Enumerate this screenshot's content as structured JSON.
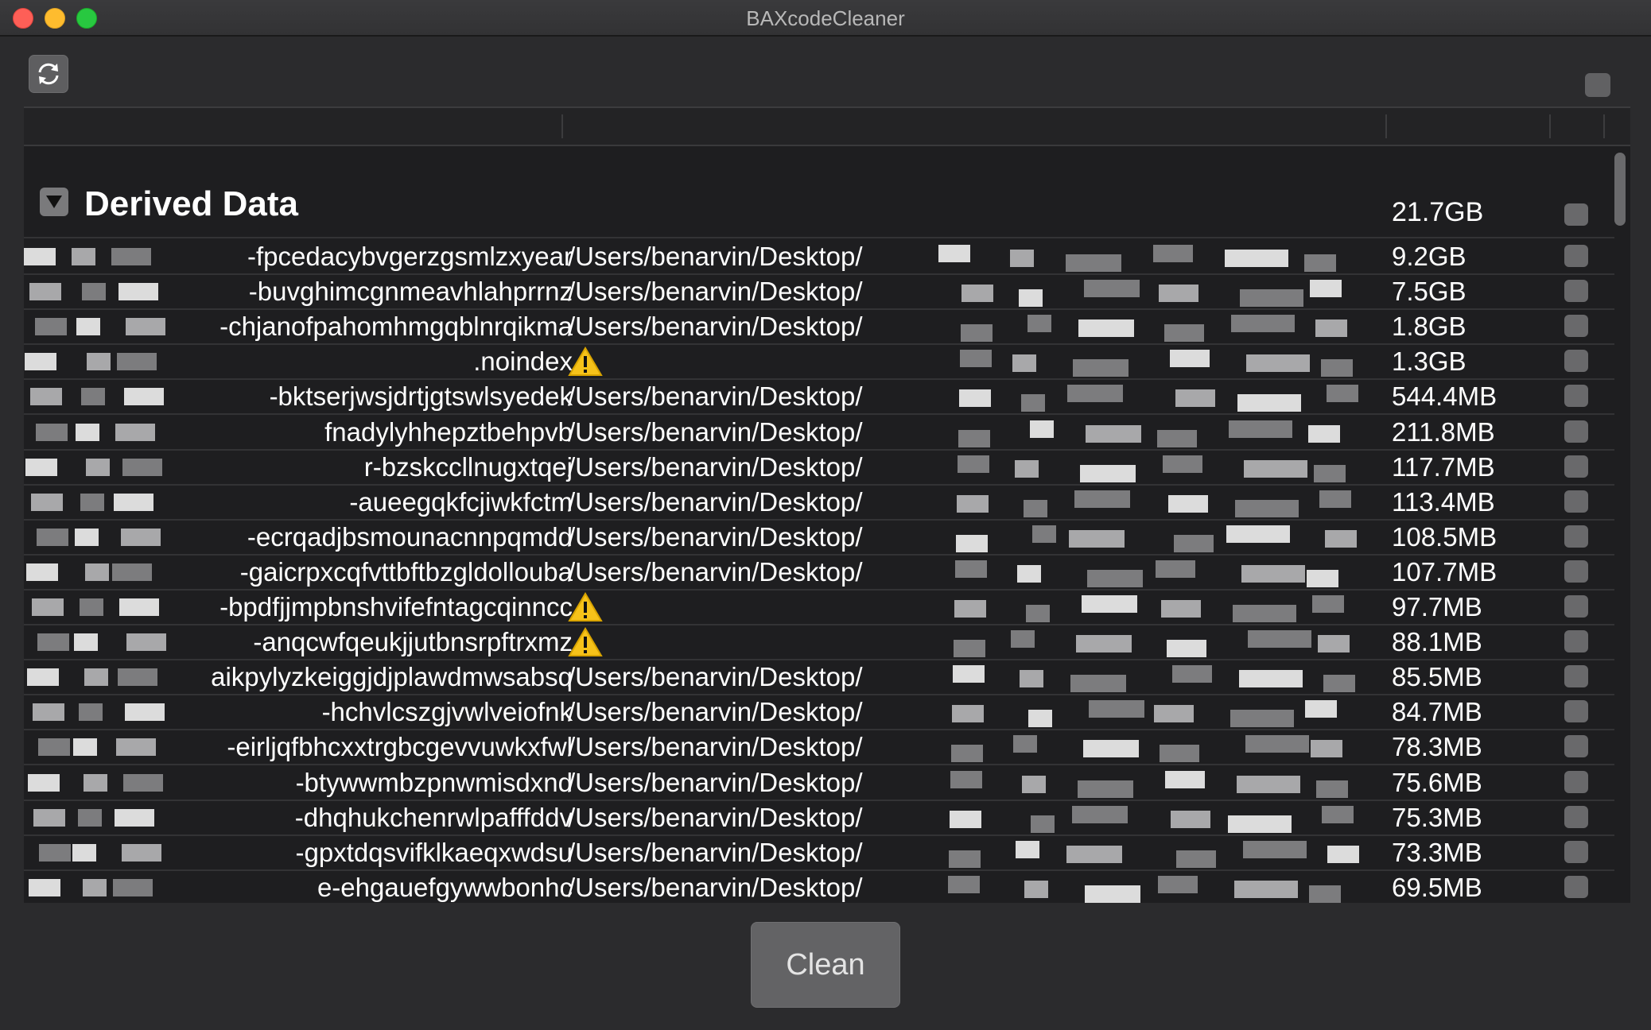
{
  "window": {
    "title": "BAXcodeCleaner"
  },
  "toolbar": {
    "refresh_icon": "refresh-icon"
  },
  "group": {
    "title": "Derived Data",
    "total_size": "21.7GB"
  },
  "rows": [
    {
      "name": "-fpcedacybvgerzgsmlzxyear",
      "path": "/Users/benarvin/Desktop/",
      "size": "9.2GB",
      "warning": false
    },
    {
      "name": "-buvghimcgnmeavhlahprrnz",
      "path": "/Users/benarvin/Desktop/",
      "size": "7.5GB",
      "warning": false
    },
    {
      "name": "-chjanofpahomhmgqblnrqikma",
      "path": "/Users/benarvin/Desktop/",
      "size": "1.8GB",
      "warning": false
    },
    {
      "name": ".noindex",
      "path": "",
      "size": "1.3GB",
      "warning": true
    },
    {
      "name": "-bktserjwsjdrtjgtswlsyedek",
      "path": "/Users/benarvin/Desktop/",
      "size": "544.4MB",
      "warning": false
    },
    {
      "name": "fnadylyhhepztbehpvb",
      "path": "/Users/benarvin/Desktop/",
      "size": "211.8MB",
      "warning": false
    },
    {
      "name": "r-bzskccllnugxtqej",
      "path": "/Users/benarvin/Desktop/",
      "size": "117.7MB",
      "warning": false
    },
    {
      "name": "-aueegqkfcjiwkfctm",
      "path": "/Users/benarvin/Desktop/",
      "size": "113.4MB",
      "warning": false
    },
    {
      "name": "-ecrqadjbsmounacnnpqmdd",
      "path": "/Users/benarvin/Desktop/",
      "size": "108.5MB",
      "warning": false
    },
    {
      "name": "-gaicrpxcqfvttbftbzgldollouba",
      "path": "/Users/benarvin/Desktop/",
      "size": "107.7MB",
      "warning": false
    },
    {
      "name": "-bpdfjjmpbnshvifefntagcqinncc",
      "path": "",
      "size": "97.7MB",
      "warning": true
    },
    {
      "name": "-anqcwfqeukjjutbnsrpftrxmz",
      "path": "",
      "size": "88.1MB",
      "warning": true
    },
    {
      "name": "aikpylyzkeiggjdjplawdmwsabsq",
      "path": "/Users/benarvin/Desktop/",
      "size": "85.5MB",
      "warning": false
    },
    {
      "name": "-hchvlcszgjvwlveiofnk",
      "path": "/Users/benarvin/Desktop/",
      "size": "84.7MB",
      "warning": false
    },
    {
      "name": "-eirljqfbhcxxtrgbcgevvuwkxfwl",
      "path": "/Users/benarvin/Desktop/",
      "size": "78.3MB",
      "warning": false
    },
    {
      "name": "-btywwmbzpnwmisdxnd",
      "path": "/Users/benarvin/Desktop/",
      "size": "75.6MB",
      "warning": false
    },
    {
      "name": "-dhqhukchenrwlpafffddv",
      "path": "/Users/benarvin/Desktop/",
      "size": "75.3MB",
      "warning": false
    },
    {
      "name": "-gpxtdqsvifklkaeqxwdsu",
      "path": "/Users/benarvin/Desktop/",
      "size": "73.3MB",
      "warning": false
    },
    {
      "name": "e-ehgauefgywwbonhc",
      "path": "/Users/benarvin/Desktop/",
      "size": "69.5MB",
      "warning": false
    }
  ],
  "footer": {
    "clean_label": "Clean"
  }
}
